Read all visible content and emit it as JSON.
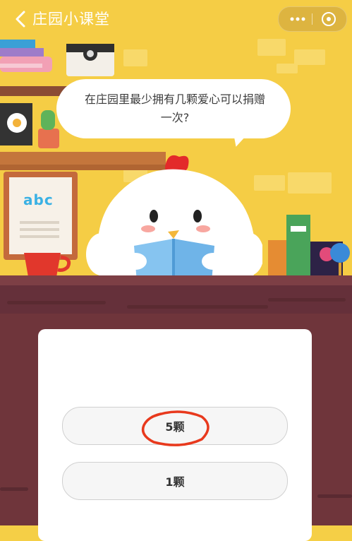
{
  "header": {
    "title": "庄园小课堂",
    "back_icon": "chevron-left-icon",
    "more_icon": "more-dots-icon",
    "close_icon": "close-circle-icon"
  },
  "question": {
    "text": "在庄园里最少拥有几颗爱心可以捐赠一次?"
  },
  "illustration": {
    "card_letters": "abc"
  },
  "options": [
    {
      "label": "5颗",
      "selected": true
    },
    {
      "label": "1颗",
      "selected": false
    }
  ],
  "colors": {
    "wall": "#f5cd45",
    "desk": "#6f353b",
    "highlight_ring": "#e8391d"
  }
}
